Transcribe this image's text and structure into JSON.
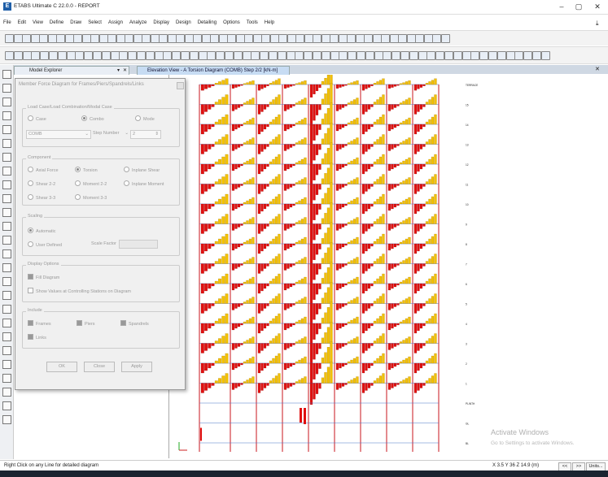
{
  "window": {
    "title": "ETABS Ultimate C 22.0.0 - REPORT",
    "app_icon_letter": "E",
    "minimize": "–",
    "maximize": "▢",
    "close": "✕"
  },
  "menu": [
    "File",
    "Edit",
    "View",
    "Define",
    "Draw",
    "Select",
    "Assign",
    "Analyze",
    "Display",
    "Design",
    "Detailing",
    "Options",
    "Tools",
    "Help"
  ],
  "tabs": {
    "model_explorer": "Model Explorer",
    "elevation": "Elevation View - A   Torsion Diagram   (COMB)  Step 2/2  [kN-m]",
    "pin": "▾",
    "close": "✕"
  },
  "dialog": {
    "title": "Member Force Diagram for Frames/Piers/Spandrels/Links",
    "load_group": {
      "label": "Load Case/Load Combination/Modal Case",
      "options": [
        "Case",
        "Combo",
        "Mode"
      ],
      "selected": "Combo",
      "combo_value": "COMB",
      "step_label": "Step Number",
      "step_value": "2"
    },
    "component": {
      "label": "Component",
      "options": [
        "Axial Force",
        "Torsion",
        "Inplane Shear",
        "Shear 2-2",
        "Moment 2-2",
        "Inplane Moment",
        "Shear 3-3",
        "Moment 3-3"
      ],
      "selected": "Torsion"
    },
    "scaling": {
      "label": "Scaling",
      "automatic": "Automatic",
      "user_defined": "User Defined",
      "scale_factor": "Scale Factor"
    },
    "display_options": {
      "label": "Display Options",
      "fill_diagram": "Fill Diagram",
      "show_values": "Show Values at Controlling Stations on Diagram"
    },
    "include": {
      "label": "Include",
      "frames": "Frames",
      "piers": "Piers",
      "spandrels": "Spandrels",
      "links": "Links"
    },
    "buttons": {
      "ok": "OK",
      "close": "Close",
      "apply": "Apply"
    }
  },
  "story_labels": [
    "TERRACE",
    "15",
    "14",
    "13",
    "12",
    "11",
    "10",
    "9",
    "8",
    "7",
    "6",
    "5",
    "4",
    "3",
    "2",
    "1",
    "PLINTH",
    "GL",
    "BL"
  ],
  "chart_data": {
    "type": "other",
    "title": "",
    "colors": {
      "positive": "#f2c100",
      "negative": "#e01010",
      "frame": "#c8141e",
      "grid": "#4a78c8"
    }
  },
  "watermark": {
    "line1": "Activate Windows",
    "line2": "Go to Settings to activate Windows."
  },
  "status": {
    "left": "Right Click on any Line for detailed diagram",
    "coords": "X 3.5  Y 36  Z 14.9 (m)",
    "prev": "<<",
    "next": ">>",
    "units": "Units..."
  }
}
